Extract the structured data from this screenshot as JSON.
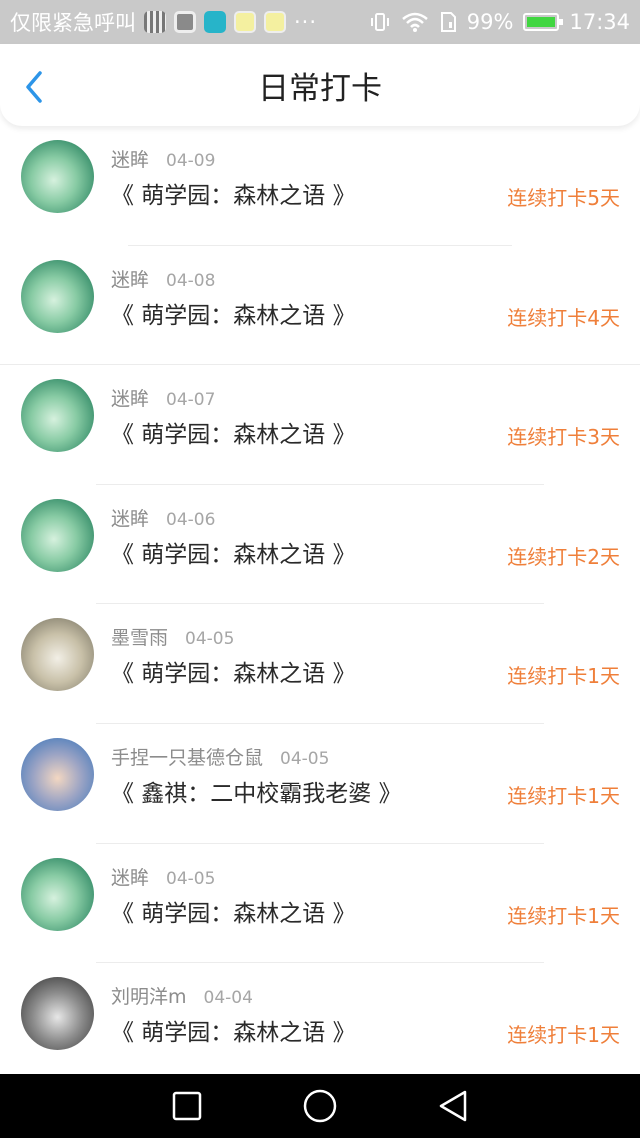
{
  "status_bar": {
    "carrier": "仅限紧急呼叫",
    "more": "···",
    "battery": "99%",
    "time": "17:34"
  },
  "header": {
    "title": "日常打卡",
    "back_icon": "chevron-left-icon"
  },
  "entries": [
    {
      "user": "迷眸",
      "date": "04-09",
      "book": "《 萌学园：森林之语 》",
      "streak": "连续打卡5天",
      "avatar": "forest"
    },
    {
      "user": "迷眸",
      "date": "04-08",
      "book": "《 萌学园：森林之语 》",
      "streak": "连续打卡4天",
      "avatar": "forest"
    },
    {
      "user": "迷眸",
      "date": "04-07",
      "book": "《 萌学园：森林之语 》",
      "streak": "连续打卡3天",
      "avatar": "forest"
    },
    {
      "user": "迷眸",
      "date": "04-06",
      "book": "《 萌学园：森林之语 》",
      "streak": "连续打卡2天",
      "avatar": "forest"
    },
    {
      "user": "墨雪雨",
      "date": "04-05",
      "book": "《 萌学园：森林之语 》",
      "streak": "连续打卡1天",
      "avatar": "girl"
    },
    {
      "user": "手捏一只基德仓鼠",
      "date": "04-05",
      "book": "《 鑫祺：二中校霸我老婆 》",
      "streak": "连续打卡1天",
      "avatar": "hamster"
    },
    {
      "user": "迷眸",
      "date": "04-05",
      "book": "《 萌学园：森林之语 》",
      "streak": "连续打卡1天",
      "avatar": "forest"
    },
    {
      "user": "刘明洋m",
      "date": "04-04",
      "book": "《 萌学园：森林之语 》",
      "streak": "连续打卡1天",
      "avatar": "couple"
    }
  ],
  "colors": {
    "accent_orange": "#ef7f3a",
    "back_blue": "#2d95e8",
    "status_bar_bg": "#c9c9c9"
  },
  "nav_bar": {
    "icons": [
      "recent-apps-icon",
      "home-icon",
      "back-triangle-icon"
    ]
  }
}
